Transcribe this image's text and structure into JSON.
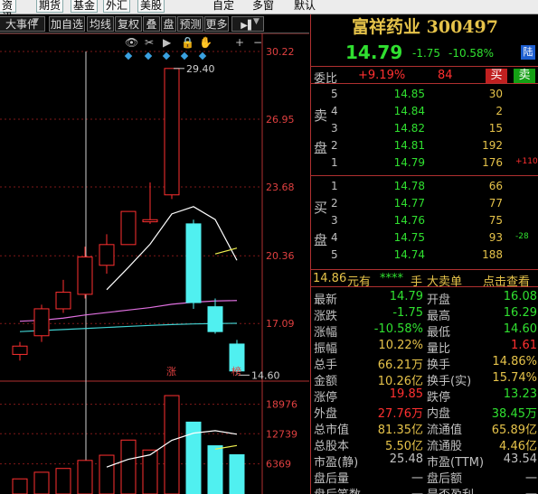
{
  "colors": {
    "up": "#ff3030",
    "down": "#30e030",
    "accent": "#e6c34a",
    "bg": "#000000",
    "grid": "#b03030"
  },
  "top_tabs": [
    {
      "label": "资讯",
      "boxed": true
    },
    {
      "label": "期货",
      "boxed": true
    },
    {
      "label": "基金",
      "boxed": true
    },
    {
      "label": "外汇",
      "boxed": true
    },
    {
      "label": "美股",
      "boxed": true
    },
    {
      "label": "自定",
      "boxed": false
    },
    {
      "label": "多窗",
      "boxed": false
    },
    {
      "label": "默认",
      "boxed": false
    }
  ],
  "toolbar": {
    "items": [
      "大事件",
      "加自选",
      "均线",
      "复权",
      "叠",
      "盘",
      "预测",
      "更多"
    ],
    "dropdown_glyph": "▼",
    "icons": [
      "eye-icon",
      "scissors-icon",
      "play-icon",
      "lock-icon",
      "hand-icon",
      "zoom-in-icon",
      "zoom-out-icon"
    ]
  },
  "stock": {
    "name": "富祥药业 300497",
    "price": "14.79",
    "change": "-1.75",
    "change_pct": "-10.58%",
    "market_badge": "陆"
  },
  "weibi": {
    "label": "委比",
    "pct": "+9.19%",
    "diff": "84",
    "buy_label": "买",
    "sell_label": "卖"
  },
  "sell_book": {
    "side_chars": [
      "卖",
      "盘"
    ],
    "rows": [
      {
        "level": "5",
        "price": "14.85",
        "vol": "30",
        "delta": ""
      },
      {
        "level": "4",
        "price": "14.84",
        "vol": "2",
        "delta": ""
      },
      {
        "level": "3",
        "price": "14.82",
        "vol": "15",
        "delta": ""
      },
      {
        "level": "2",
        "price": "14.81",
        "vol": "192",
        "delta": ""
      },
      {
        "level": "1",
        "price": "14.79",
        "vol": "176",
        "delta": "+110"
      }
    ]
  },
  "buy_book": {
    "side_chars": [
      "买",
      "盘"
    ],
    "rows": [
      {
        "level": "1",
        "price": "14.78",
        "vol": "66",
        "delta": ""
      },
      {
        "level": "2",
        "price": "14.77",
        "vol": "77",
        "delta": ""
      },
      {
        "level": "3",
        "price": "14.76",
        "vol": "75",
        "delta": ""
      },
      {
        "level": "4",
        "price": "14.75",
        "vol": "93",
        "delta": "-28"
      },
      {
        "level": "5",
        "price": "14.74",
        "vol": "188",
        "delta": ""
      }
    ]
  },
  "tick_bar": {
    "price": "14.86",
    "unit": "元有",
    "stars": "****",
    "hand": "手",
    "order": "大卖单",
    "action": "点击查看"
  },
  "stats": [
    {
      "l1": "最新",
      "v1": "14.79",
      "c1": "down",
      "l2": "开盘",
      "v2": "16.08",
      "c2": "down"
    },
    {
      "l1": "涨跌",
      "v1": "-1.75",
      "c1": "down",
      "l2": "最高",
      "v2": "16.29",
      "c2": "down"
    },
    {
      "l1": "涨幅",
      "v1": "-10.58%",
      "c1": "down",
      "l2": "最低",
      "v2": "14.60",
      "c2": "down"
    },
    {
      "l1": "振幅",
      "v1": "10.22%",
      "c1": "accent",
      "l2": "量比",
      "v2": "1.61",
      "c2": "up"
    },
    {
      "l1": "总手",
      "v1": "66.21万",
      "c1": "accent",
      "l2": "换手",
      "v2": "14.86%",
      "c2": "accent"
    },
    {
      "l1": "金额",
      "v1": "10.26亿",
      "c1": "accent",
      "l2": "换手(实)",
      "v2": "15.74%",
      "c2": "accent"
    },
    {
      "l1": "涨停",
      "v1": "19.85",
      "c1": "up",
      "l2": "跌停",
      "v2": "13.23",
      "c2": "down"
    },
    {
      "l1": "外盘",
      "v1": "27.76万",
      "c1": "up",
      "l2": "内盘",
      "v2": "38.45万",
      "c2": "down"
    },
    {
      "l1": "总市值",
      "v1": "81.35亿",
      "c1": "accent",
      "l2": "流通值",
      "v2": "65.89亿",
      "c2": "accent"
    },
    {
      "l1": "总股本",
      "v1": "5.50亿",
      "c1": "accent",
      "l2": "流通股",
      "v2": "4.46亿",
      "c2": "accent"
    },
    {
      "l1": "市盈(静)",
      "v1": "25.48",
      "c1": "plain",
      "l2": "市盈(TTM)",
      "v2": "43.54",
      "c2": "plain"
    },
    {
      "l1": "盘后量",
      "v1": "一",
      "c1": "plain",
      "l2": "盘后额",
      "v2": "一",
      "c2": "plain"
    },
    {
      "l1": "盘后笔数",
      "v1": "一",
      "c1": "plain",
      "l2": "是否盈利",
      "v2": "一",
      "c2": "plain"
    }
  ],
  "chart_data": {
    "type": "candlestick",
    "price_axis_labels": [
      "30.22",
      "26.95",
      "23.68",
      "20.36",
      "17.09"
    ],
    "price_range": [
      15.4,
      30.22
    ],
    "high_label": "29.40",
    "low_label": "14.60",
    "volume_axis_labels": [
      "18976",
      "12739",
      "6369"
    ],
    "volume_max": 21000,
    "day_markers": [
      {
        "label": "涨",
        "index": 7
      },
      {
        "label": "榜",
        "index": 10
      }
    ],
    "candles": [
      {
        "o": 15.6,
        "h": 16.2,
        "l": 15.3,
        "c": 16.0
      },
      {
        "o": 16.5,
        "h": 18.0,
        "l": 16.2,
        "c": 17.8
      },
      {
        "o": 17.8,
        "h": 19.2,
        "l": 17.6,
        "c": 18.6
      },
      {
        "o": 18.5,
        "h": 20.8,
        "l": 18.3,
        "c": 20.3
      },
      {
        "o": 19.9,
        "h": 21.4,
        "l": 19.5,
        "c": 20.9
      },
      {
        "o": 20.9,
        "h": 22.5,
        "l": 20.9,
        "c": 22.5
      },
      {
        "o": 22.0,
        "h": 23.9,
        "l": 21.9,
        "c": 22.1
      },
      {
        "o": 23.3,
        "h": 29.4,
        "l": 23.1,
        "c": 29.4
      },
      {
        "o": 21.9,
        "h": 22.1,
        "l": 17.8,
        "c": 18.1
      },
      {
        "o": 17.9,
        "h": 18.3,
        "l": 16.6,
        "c": 16.7
      },
      {
        "o": 16.1,
        "h": 16.3,
        "l": 14.6,
        "c": 14.8
      }
    ],
    "ma_lines": [
      {
        "name": "MA5",
        "color": "#ffffff",
        "values": [
          null,
          null,
          null,
          null,
          18.72,
          19.8,
          20.92,
          22.38,
          22.73,
          22.11,
          20.14
        ]
      },
      {
        "name": "MA10",
        "color": "#f0f050",
        "values": [
          null,
          null,
          null,
          null,
          null,
          null,
          null,
          null,
          null,
          20.45,
          20.73
        ]
      },
      {
        "name": "MA20",
        "color": "#e070e0",
        "values": [
          17.2,
          17.25,
          17.35,
          17.5,
          17.62,
          17.74,
          17.86,
          18.02,
          18.12,
          18.18,
          18.2
        ]
      },
      {
        "name": "MA60",
        "color": "#40d0d0",
        "values": [
          16.7,
          16.75,
          16.8,
          16.85,
          16.9,
          16.95,
          17.0,
          17.04,
          17.07,
          17.09,
          17.1
        ]
      }
    ],
    "volumes": [
      3200,
      4600,
      5400,
      7100,
      8200,
      11400,
      9300,
      20800,
      15200,
      10200,
      8300
    ],
    "vol_ma": [
      {
        "color": "#ffffff",
        "values": [
          null,
          null,
          null,
          null,
          5700,
          7340,
          8280,
          11360,
          12860,
          13380,
          12640
        ]
      },
      {
        "color": "#f0f050",
        "values": [
          null,
          null,
          null,
          null,
          null,
          null,
          null,
          null,
          null,
          9490,
          10250
        ]
      }
    ]
  }
}
